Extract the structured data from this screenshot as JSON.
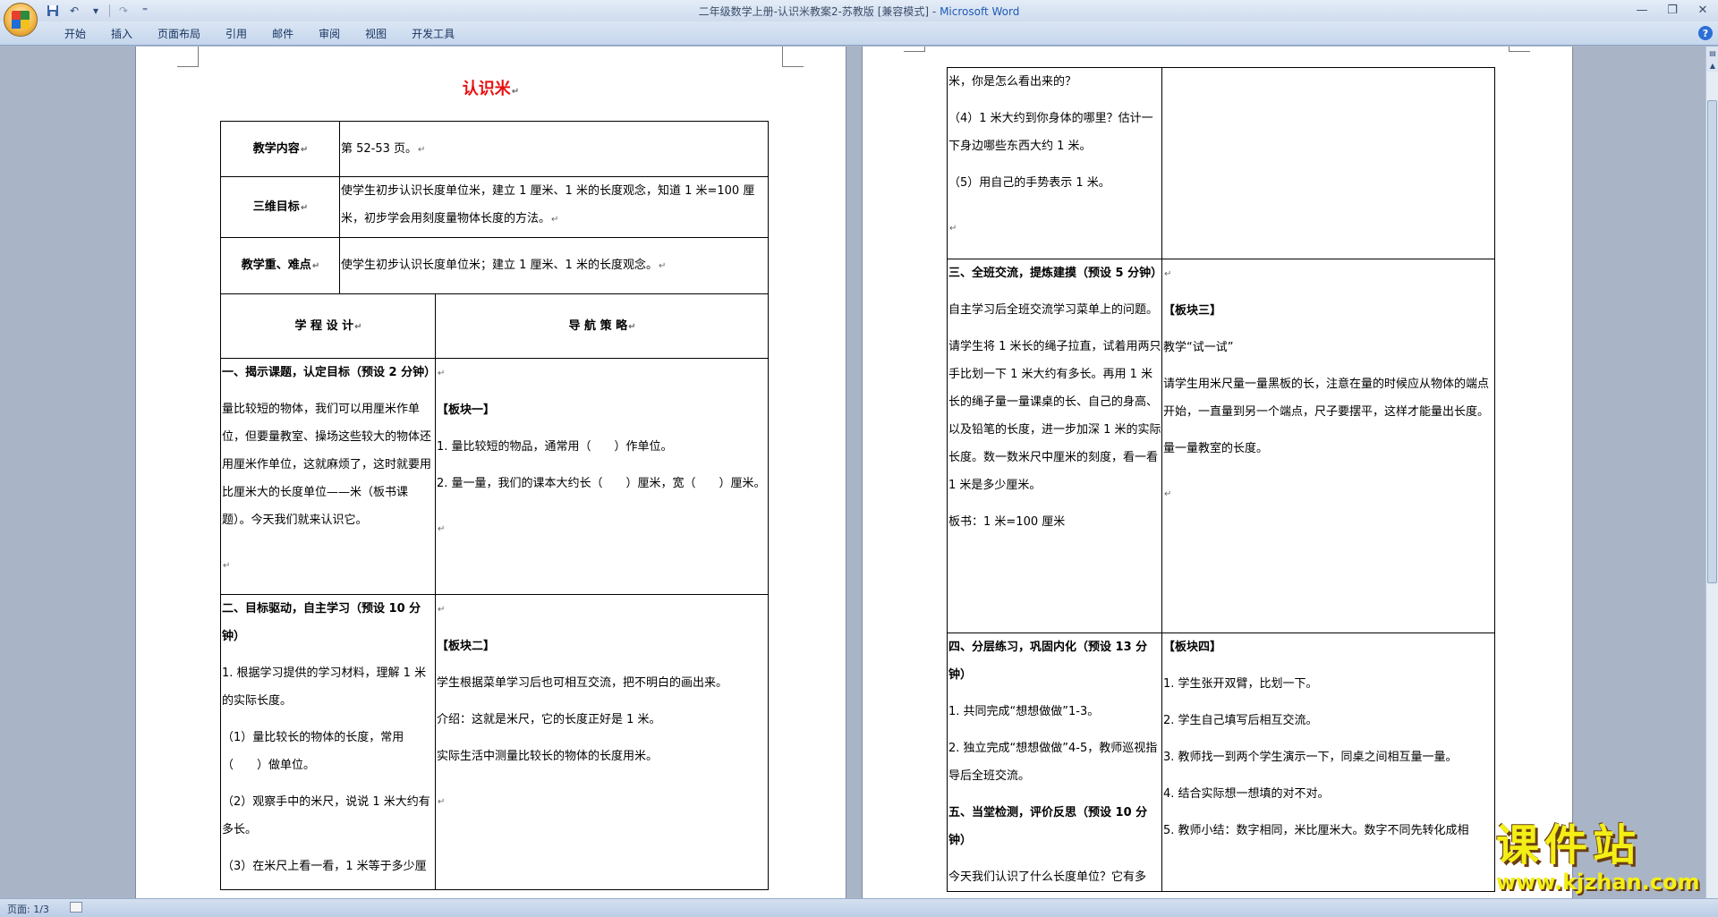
{
  "window": {
    "title_doc": "二年级数学上册-认识米教案2-苏教版 [兼容模式] -",
    "title_app": "Microsoft Word",
    "qat": {
      "more": "⁼"
    }
  },
  "ribbon": {
    "tabs": [
      "开始",
      "插入",
      "页面布局",
      "引用",
      "邮件",
      "审阅",
      "视图",
      "开发工具"
    ]
  },
  "statusbar": {
    "pages": "页面: 1/3"
  },
  "watermark": {
    "text": "课件站",
    "url": "www.kjzhan.com"
  },
  "page1": {
    "title": "认识米",
    "rows": {
      "content_label": "教学内容",
      "content_value": "第 52-53 页。",
      "goal_label": "三维目标",
      "goal_value": "使学生初步认识长度单位米，建立 1 厘米、1 米的长度观念，知道 1 米=100 厘米，初步学会用刻度量物体长度的方法。",
      "key_label": "教学重、难点",
      "key_value": "使学生初步认识长度单位米；建立 1 厘米、1 米的长度观念。",
      "col_left": "学 程 设 计",
      "col_right": "导 航 策 略"
    },
    "sec1": {
      "title": "一、揭示课题，认定目标（预设 2 分钟）",
      "left_text": "量比较短的物体，我们可以用厘米作单位，但要量教室、操场这些较大的物体还用厘米作单位，这就麻烦了，这时就要用比厘米大的长度单位——米（板书课题）。今天我们就来认识它。",
      "block": "【板块一】",
      "r1": "1. 量比较短的物品，通常用（　　）作单位。",
      "r2": "2. 量一量，我们的课本大约长（　　）厘米，宽（　　）厘米。"
    },
    "sec2": {
      "title": "二、目标驱动，自主学习（预设 10 分钟）",
      "l1": "1. 根据学习提供的学习材料，理解 1 米的实际长度。",
      "l2": "（1）量比较长的物体的长度，常用（　　）做单位。",
      "l3": "（2）观察手中的米尺，说说 1 米大约有多长。",
      "l4": "（3）在米尺上看一看，1 米等于多少厘",
      "block": "【板块二】",
      "r1": "学生根据菜单学习后也可相互交流，把不明白的画出来。",
      "r2": "介绍：这就是米尺，它的长度正好是 1 米。",
      "r3": "实际生活中测量比较长的物体的长度用米。"
    }
  },
  "page2": {
    "cont": {
      "l1": "米，你是怎么看出来的？",
      "l2": "（4）1 米大约到你身体的哪里？估计一下身边哪些东西大约 1 米。",
      "l3": "（5）用自己的手势表示 1 米。"
    },
    "sec3": {
      "title": "三、全班交流，提炼建摸（预设 5 分钟）",
      "l1": "自主学习后全班交流学习菜单上的问题。",
      "l2": "请学生将 1 米长的绳子拉直，试着用两只手比划一下 1 米大约有多长。再用 1 米长的绳子量一量课桌的长、自己的身高、以及铅笔的长度，进一步加深 1 米的实际长度。数一数米尺中厘米的刻度，看一看 1 米是多少厘米。",
      "l3": "板书：1 米=100 厘米",
      "block": "【板块三】",
      "r1": "教学“试一试”",
      "r2": "请学生用米尺量一量黑板的长，注意在量的时候应从物体的端点开始，一直量到另一个端点，尺子要摆平，这样才能量出长度。",
      "r3": "量一量教室的长度。"
    },
    "sec4": {
      "title": "四、分层练习，巩固内化（预设 13 分钟）",
      "l1": "1. 共同完成“想想做做”1-3。",
      "l2": "2. 独立完成“想想做做”4-5，教师巡视指导后全班交流。",
      "block": "【板块四】",
      "r1": "1. 学生张开双臂，比划一下。",
      "r2": "2. 学生自己填写后相互交流。",
      "r3": "3. 教师找一到两个学生演示一下，同桌之间相互量一量。",
      "r4": "4. 结合实际想一想填的对不对。",
      "r5": "5. 教师小结：数字相同，米比厘米大。数字不同先转化成相"
    },
    "sec5": {
      "title": "五、当堂检测，评价反思（预设 10 分钟）",
      "l1": "今天我们认识了什么长度单位？它有多"
    }
  }
}
